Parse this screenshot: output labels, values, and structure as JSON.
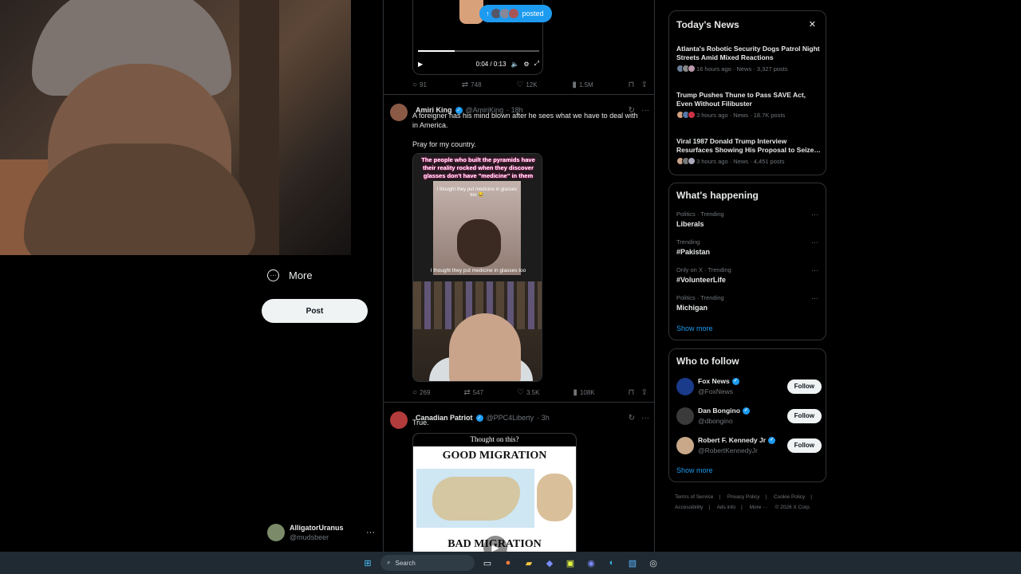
{
  "left_nav": {
    "more_label": "More",
    "post_label": "Post",
    "account": {
      "name": "AlligatorUranus",
      "handle": "@mudsbeer"
    }
  },
  "feed": {
    "top_video": {
      "time": "0:04 / 0:13",
      "posted_label": "posted",
      "actions": {
        "replies": "91",
        "reposts": "748",
        "likes": "12K",
        "views": "1.5M"
      }
    },
    "tweet1": {
      "name": "Amiri King",
      "handle": "@AmiriKing",
      "time": "· 18h",
      "text": "A foreigner has his mind blown after he sees what we have to deal with in America.\n\nPray for my country.",
      "media_caption": "The people who built the pyramids have their reality rocked when they discover glasses don't have \"medicine\" in them",
      "media_inner_caption": "I thought they put medicine in glasses too 😂",
      "media_subtitle": "I thought they put medicine in glasses too",
      "actions": {
        "replies": "269",
        "reposts": "547",
        "likes": "3.5K",
        "views": "108K"
      }
    },
    "tweet2": {
      "name": "Canadian Patriot",
      "handle": "@PPC4Liberty",
      "time": "· 3h",
      "text": "True.",
      "meme_top": "Thought on this?",
      "meme_good": "GOOD MIGRATION",
      "meme_bad": "BAD MIGRATION"
    }
  },
  "news": {
    "title": "Today's News",
    "items": [
      {
        "title": "Atlanta's Robotic Security Dogs Patrol Night Streets Amid Mixed Reactions",
        "meta": "16 hours ago · News · 3,327 posts"
      },
      {
        "title": "Trump Pushes Thune to Pass SAVE Act, Even Without Filibuster",
        "meta": "3 hours ago · News · 18.7K posts"
      },
      {
        "title": "Viral 1987 Donald Trump Interview Resurfaces Showing His Proposal to Seize…",
        "meta": "3 hours ago · News · 4,451 posts"
      }
    ]
  },
  "happening": {
    "title": "What's happening",
    "trends": [
      {
        "context": "Politics · Trending",
        "name": "Liberals"
      },
      {
        "context": "Trending",
        "name": "#Pakistan"
      },
      {
        "context": "Only on X · Trending",
        "name": "#VolunteerLife"
      },
      {
        "context": "Politics · Trending",
        "name": "Michigan"
      }
    ],
    "show_more": "Show more"
  },
  "who_to_follow": {
    "title": "Who to follow",
    "accounts": [
      {
        "name": "Fox News",
        "handle": "@FoxNews",
        "button": "Follow"
      },
      {
        "name": "Dan Bongino",
        "handle": "@dbongino",
        "button": "Follow"
      },
      {
        "name": "Robert F. Kennedy Jr",
        "handle": "@RobertKennedyJr",
        "button": "Follow"
      }
    ],
    "show_more": "Show more"
  },
  "footer": {
    "links": [
      "Terms of Service",
      "|",
      "Privacy Policy",
      "|",
      "Cookie Policy",
      "|",
      "Accessibility",
      "|",
      "Ads info",
      "|",
      "More ···",
      "© 2026 X Corp."
    ]
  },
  "taskbar": {
    "search_label": "Search"
  },
  "colors": {
    "accent": "#1d9bf0",
    "background": "#000000",
    "border": "#2f3336",
    "muted": "#71767b"
  }
}
